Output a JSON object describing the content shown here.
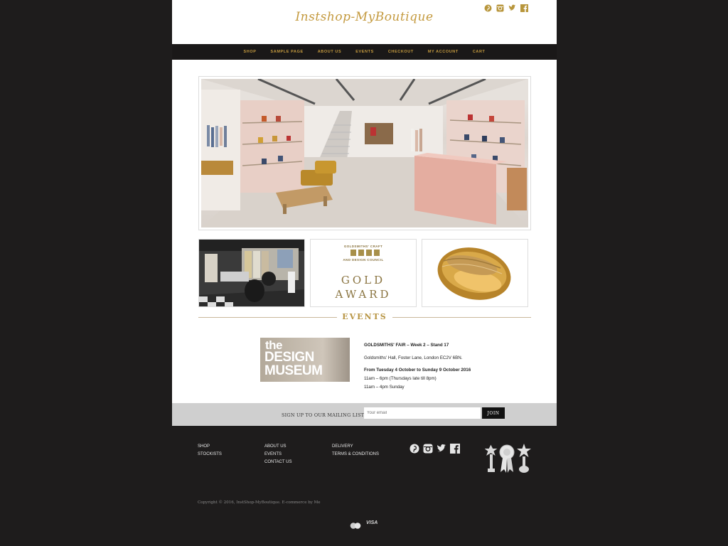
{
  "header": {
    "logo_text": "Instshop-MyBoutique",
    "social_icons": [
      "pinterest-icon",
      "instagram-icon",
      "twitter-icon",
      "facebook-icon"
    ]
  },
  "nav": {
    "items": [
      "SHOP",
      "SAMPLE PAGE",
      "ABOUT US",
      "EVENTS",
      "CHECKOUT",
      "MY ACCOUNT",
      "CART"
    ]
  },
  "tiles": {
    "goldsmiths_line1": "GOLDSMITHS' CRAFT",
    "goldsmiths_line2": "AND DESIGN COUNCIL",
    "award_line1": "GOLD",
    "award_line2": "AWARD"
  },
  "events": {
    "heading": "EVENTS",
    "logo_line1": "the",
    "logo_line2": "DESIGN",
    "logo_line3": "MUSEUM",
    "title": "GOLDSMITHS' FAIR – Week 2 – Stand 17",
    "address": "Goldsmiths' Hall, Foster Lane, London EC2V 6BN.",
    "dates": "From Tuesday 4 October to Sunday 9 October 2016",
    "hours_weekday": "11am – 6pm (Thursdays late till 8pm)",
    "hours_sunday": "11am – 4pm Sunday"
  },
  "mailing": {
    "label": "SIGN UP TO OUR MAILING LIST",
    "placeholder": "Your email",
    "button": "JOIN"
  },
  "footer": {
    "col1": [
      "SHOP",
      "STOCKISTS"
    ],
    "col2": [
      "ABOUT US",
      "EVENTS",
      "CONTACT US"
    ],
    "col3": [
      "DELIVERY",
      "TERMS & CONDITIONS"
    ],
    "social_icons": [
      "pinterest-icon",
      "instagram-icon",
      "twitter-icon",
      "facebook-icon"
    ],
    "copyright": "Copyright © 2016, InstShop-MyBoutique. E-commerce by Me",
    "payment_visa": "VISA"
  },
  "colors": {
    "gold": "#c49a3f",
    "background": "#1e1c1c",
    "nav_bg": "#1a1818"
  }
}
